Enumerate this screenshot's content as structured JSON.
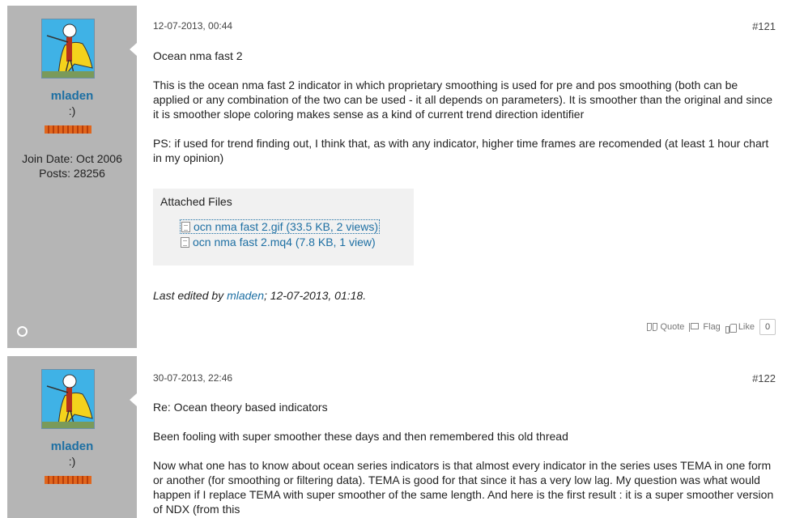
{
  "posts": [
    {
      "username": "mladen",
      "user_title": ":)",
      "join_date": "Join Date: Oct 2006",
      "posts_count": "Posts: 28256",
      "date": "12-07-2013, 00:44",
      "number": "#121",
      "title": "Ocean nma fast 2",
      "paragraph1": "This is the ocean nma fast 2 indicator in which proprietary smoothing is used for pre and pos smoothing (both can be applied or any combination of the two can be used - it all depends on parameters). It is smoother than the original and since it is smoother slope coloring makes sense as a kind of current trend direction identifier",
      "paragraph2": "PS: if used for trend finding out, I think that, as with any indicator, higher time frames are recomended (at least 1 hour chart in my opinion)",
      "attachments_title": "Attached Files",
      "attachments": [
        "ocn nma fast 2.gif (33.5 KB, 2 views)",
        "ocn nma fast 2.mq4 (7.8 KB, 1 view)"
      ],
      "last_edited_prefix": "Last edited by ",
      "last_edited_user": "mladen",
      "last_edited_suffix": "; 12-07-2013, 01:18.",
      "actions": {
        "quote": "Quote",
        "flag": "Flag",
        "like": "Like",
        "like_count": "0"
      }
    },
    {
      "username": "mladen",
      "user_title": ":)",
      "date": "30-07-2013, 22:46",
      "number": "#122",
      "title": "Re: Ocean theory based indicators",
      "paragraph1": "Been fooling with super smoother these days and then remembered this old thread",
      "paragraph2": "Now what one has to know about ocean series indicators is that almost every indicator in the series uses TEMA in one form or another (for smoothing or filtering data). TEMA is good for that since it has a very low lag. My question was what would happen if I replace TEMA with super smoother of the same length. And here is the first result : it is a super smoother version of NDX (from this"
    }
  ],
  "colors": {
    "userinfo_bg": "#b5b5b5",
    "link": "#1d6fa3",
    "reputation": "#e0661d"
  }
}
